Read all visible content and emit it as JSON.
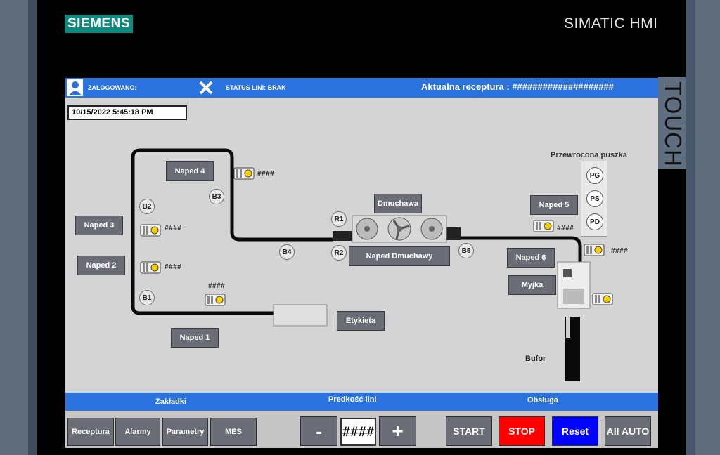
{
  "brand": {
    "logo": "SIEMENS",
    "product": "SIMATIC HMI",
    "touch_label": "TOUCH"
  },
  "header": {
    "logged_in_label": "ZALOGOWANO:",
    "line_status": "STATUS LINI: BRAK",
    "recipe": "Aktualna receptura : ####################"
  },
  "datetime": "10/15/2022 5:45:18 PM",
  "drives": {
    "naped4": "Naped 4",
    "naped3": "Naped 3",
    "naped2": "Naped 2",
    "naped1": "Naped 1",
    "naped5": "Naped 5",
    "naped6": "Naped 6",
    "dmuchawa": "Dmuchawa",
    "naped_dmuchawy": "Naped Dmuchawy",
    "etykieta": "Etykieta",
    "myjka": "Myjka"
  },
  "sensors": {
    "b1": "B1",
    "b2": "B2",
    "b3": "B3",
    "b4": "B4",
    "b5": "B5",
    "r1": "R1",
    "r2": "R2"
  },
  "motor_values": {
    "m_naped4": "####",
    "m_naped3": "####",
    "m_naped2": "####",
    "m_naped1": "####",
    "m_naped5": "####",
    "m_naped6": "####"
  },
  "tipped_can": {
    "title": "Przewrocona puszka",
    "pg": "PG",
    "ps": "PS",
    "pd": "PD"
  },
  "bufor": "Bufor",
  "footer": {
    "zakladki": "Zakładki",
    "predkosc": "Predkość lini",
    "obsluga": "Obsługa"
  },
  "buttons": {
    "receptura": "Receptura",
    "alarmy": "Alarmy",
    "parametry": "Parametry",
    "mes": "MES",
    "minus": "-",
    "plus": "+",
    "speed_value": "####",
    "start": "START",
    "stop": "STOP",
    "reset": "Reset",
    "all_auto": "All AUTO"
  },
  "colors": {
    "header_blue": "#2a73de",
    "stop_red": "#ff0000",
    "reset_blue": "#0000ff",
    "logo_teal": "#0f8a7e"
  }
}
